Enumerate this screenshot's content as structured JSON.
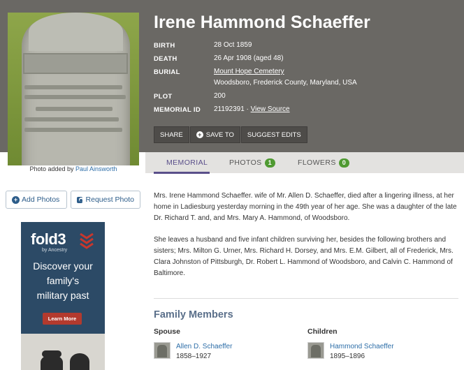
{
  "memorial": {
    "name": "Irene Hammond Schaeffer",
    "photo_added_prefix": "Photo added by ",
    "photo_added_by": "Paul Ainsworth",
    "headstone_text": "SCHAEFFER"
  },
  "facts": {
    "birth_label": "BIRTH",
    "birth_value": "28 Oct 1859",
    "death_label": "DEATH",
    "death_value": "26 Apr 1908 (aged 48)",
    "burial_label": "BURIAL",
    "burial_cemetery": "Mount Hope Cemetery",
    "burial_location": "Woodsboro, Frederick County, Maryland, USA",
    "plot_label": "PLOT",
    "plot_value": "200",
    "memorial_id_label": "MEMORIAL ID",
    "memorial_id_value": "21192391 · ",
    "view_source": "View Source"
  },
  "actions": {
    "share": "SHARE",
    "save_to": "SAVE TO",
    "suggest_edits": "SUGGEST EDITS"
  },
  "tabs": {
    "memorial": "MEMORIAL",
    "photos": "PHOTOS",
    "photos_count": "1",
    "flowers": "FLOWERS",
    "flowers_count": "0"
  },
  "sidebar": {
    "add_photos": "Add Photos",
    "request_photo": "Request Photo"
  },
  "ad": {
    "logo": "fold3",
    "sub": "by Ancestry",
    "line1": "Discover your",
    "line2": "family's",
    "line3": "military past",
    "button": "Learn More"
  },
  "bio": {
    "paragraph1": "Mrs. Irene Hammond Schaeffer. wife of Mr. Allen D. Schaeffer, died after a lingering illness, at her home in Ladiesburg yesterday morning in the 49th year of her age. She was a daughter of the late Dr. Richard T. and, and Mrs. Mary A. Hammond, of Woodsboro.",
    "paragraph2": "She leaves a husband and five infant children surviving her, besides the following brothers and sisters; Mrs. Milton G. Urner, Mrs. Richard H. Dorsey, and Mrs. E.M. Gilbert, all of Frederick, Mrs. Clara Johnston of Pittsburgh, Dr. Robert L. Hammond of Woodsboro, and Calvin C. Hammond of Baltimore."
  },
  "family": {
    "title": "Family Members",
    "spouse_label": "Spouse",
    "children_label": "Children",
    "spouse": {
      "name": "Allen D. Schaeffer",
      "dates": "1858–1927"
    },
    "child": {
      "name": "Hammond Schaeffer",
      "dates": "1895–1896"
    }
  },
  "colors": {
    "header_bg": "#6a6864",
    "accent_purple": "#5a4f8a",
    "link_blue": "#2d6ea8",
    "badge_green": "#4f9a32",
    "ad_bg": "#2c4a66"
  }
}
